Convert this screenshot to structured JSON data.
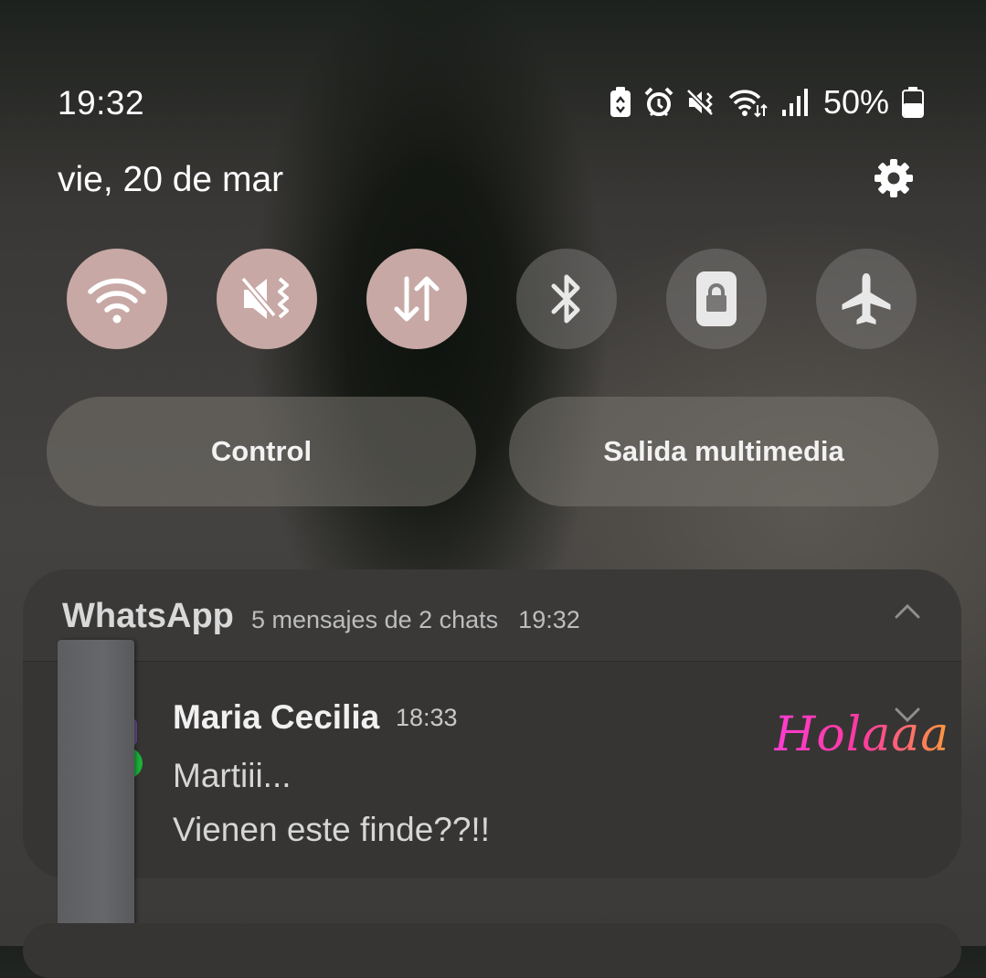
{
  "status_bar": {
    "time": "19:32",
    "battery_percent": "50%",
    "icons": [
      "battery-saver-icon",
      "alarm-icon",
      "vibrate-mute-icon",
      "wifi-data-icon",
      "signal-icon",
      "battery-icon"
    ]
  },
  "date": "vie, 20 de mar",
  "quick_toggles": [
    {
      "name": "wifi",
      "icon": "wifi-icon",
      "active": true
    },
    {
      "name": "sound",
      "icon": "mute-vibrate-icon",
      "active": true
    },
    {
      "name": "mobile-data",
      "icon": "data-transfer-icon",
      "active": true
    },
    {
      "name": "bluetooth",
      "icon": "bluetooth-icon",
      "active": false
    },
    {
      "name": "rotation-lock",
      "icon": "lock-icon",
      "active": false
    },
    {
      "name": "airplane-mode",
      "icon": "airplane-icon",
      "active": false
    }
  ],
  "buttons": {
    "control": "Control",
    "media_output": "Salida multimedia"
  },
  "notification": {
    "app_name": "WhatsApp",
    "summary": "5 mensajes de 2 chats",
    "time": "19:32",
    "message": {
      "sender": "Maria Cecilia",
      "time": "18:33",
      "line1": "Martiii...",
      "line2": "Vienen este finde??!!",
      "sticker_text": "Holaaa"
    }
  },
  "colors": {
    "toggle_active": "#c7a8a5",
    "toggle_inactive": "#6f6d6b",
    "card_bg": "#3a3938"
  }
}
